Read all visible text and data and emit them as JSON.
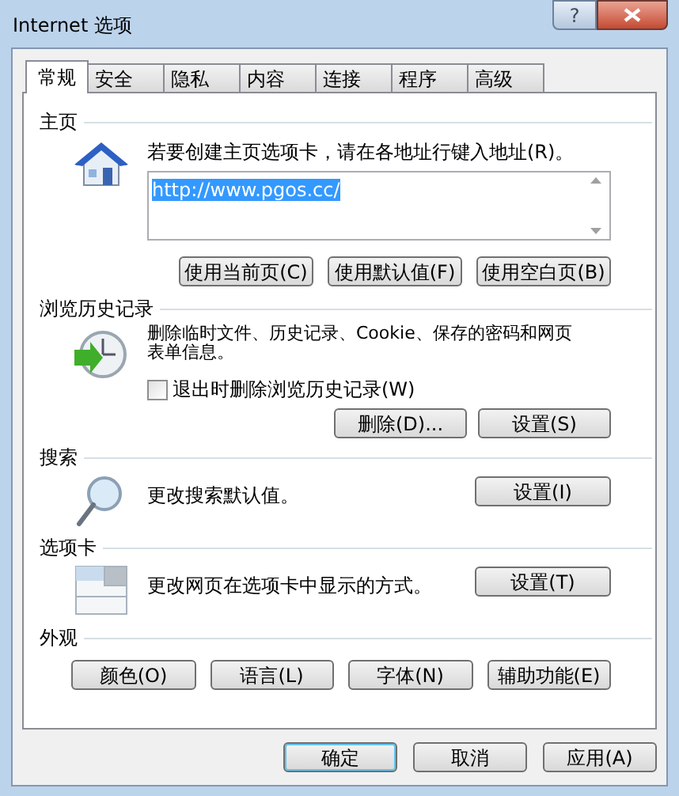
{
  "window": {
    "title": "Internet 选项",
    "help_button": "?"
  },
  "tabs": [
    {
      "label": "常规",
      "selected": true
    },
    {
      "label": "安全",
      "selected": false
    },
    {
      "label": "隐私",
      "selected": false
    },
    {
      "label": "内容",
      "selected": false
    },
    {
      "label": "连接",
      "selected": false
    },
    {
      "label": "程序",
      "selected": false
    },
    {
      "label": "高级",
      "selected": false
    }
  ],
  "sections": [
    {
      "kind": "home",
      "title": "主页",
      "description": "若要创建主页选项卡，请在各地址行键入地址(R)。",
      "url": {
        "value": "http://www.pgos.cc/",
        "selected": true
      },
      "buttons": [
        "使用当前页(C)",
        "使用默认值(F)",
        "使用空白页(B)"
      ]
    },
    {
      "kind": "history",
      "title": "浏览历史记录",
      "description": "删除临时文件、历史记录、Cookie、保存的密码和网页表单信息。",
      "checkbox": {
        "label": "退出时删除浏览历史记录(W)",
        "checked": false
      },
      "buttons": [
        "删除(D)...",
        "设置(S)"
      ]
    },
    {
      "kind": "search",
      "title": "搜索",
      "description": "更改搜索默认值。",
      "buttons": [
        "设置(I)"
      ]
    },
    {
      "kind": "tabs",
      "title": "选项卡",
      "description": "更改网页在选项卡中显示的方式。",
      "buttons": [
        "设置(T)"
      ]
    },
    {
      "kind": "appearance",
      "title": "外观",
      "buttons": [
        "颜色(O)",
        "语言(L)",
        "字体(N)",
        "辅助功能(E)"
      ]
    }
  ],
  "footer_buttons": [
    {
      "label": "确定",
      "default": true
    },
    {
      "label": "取消",
      "default": false
    },
    {
      "label": "应用(A)",
      "default": false
    }
  ]
}
